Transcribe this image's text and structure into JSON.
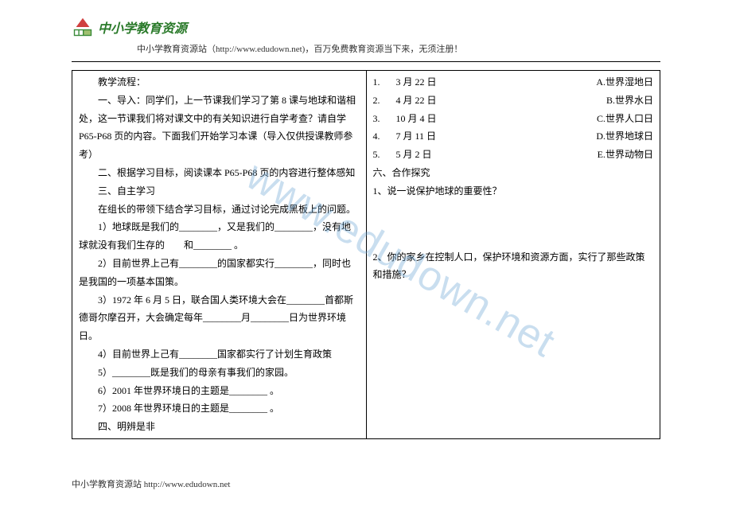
{
  "header": {
    "logo_text": "中小学教育资源",
    "subtitle": "中小学教育资源站（http://www.edudown.net)，百万免费教育资源当下来，无须注册！"
  },
  "watermark": "www.edudown.net",
  "left_column": {
    "line1": "教学流程：",
    "line2": "一、导入：同学们，上一节课我们学习了第 8 课与地球和谐相处，这一节课我们将对课文中的有关知识进行自学考查？请自学 P65-P68 页的内容。下面我们开始学习本课（导入仅供授课教师参考）",
    "line3": "二、根据学习目标，阅读课本 P65-P68 页的内容进行整体感知",
    "line4": "三、自主学习",
    "line5": "在组长的带领下结合学习目标，通过讨论完成黑板上的问题。",
    "line6_a": "1）地球既是我们的________，又是我们的________，没有地球就没有我们生存的",
    "line6_b": "和________ 。",
    "line7": "2）目前世界上己有________的国家都实行________，同时也是我国的一项基本国策。",
    "line8": "3）1972 年 6 月 5 日，联合国人类环境大会在________首都斯德哥尔摩召开，大会确定每年________月________日为世界环境日。",
    "line9": "4）目前世界上己有________国家都实行了计划生育政策",
    "line10": "5）________既是我们的母亲有事我们的家园。",
    "line11": "6）2001 年世界环境日的主题是________ 。",
    "line12": "7）2008 年世界环境日的主题是________ 。",
    "line13": "四、明辨是非"
  },
  "right_column": {
    "match": [
      {
        "num": "1.",
        "date": "3 月 22 日",
        "opt": "A.世界湿地日"
      },
      {
        "num": "2.",
        "date": "4 月 22 日",
        "opt": "B.世界水日"
      },
      {
        "num": "3.",
        "date": "10 月 4 日",
        "opt": "C.世界人口日"
      },
      {
        "num": "4.",
        "date": "7 月 11 日",
        "opt": "D.世界地球日"
      },
      {
        "num": "5.",
        "date": "5 月 2 日",
        "opt": "E.世界动物日"
      }
    ],
    "section6": "六、合作探究",
    "q1": "1、说一说保护地球的重要性？",
    "q2": "2、你的家乡在控制人口，保护环境和资源方面，实行了那些政策和措施？"
  },
  "footer": "中小学教育资源站 http://www.edudown.net"
}
